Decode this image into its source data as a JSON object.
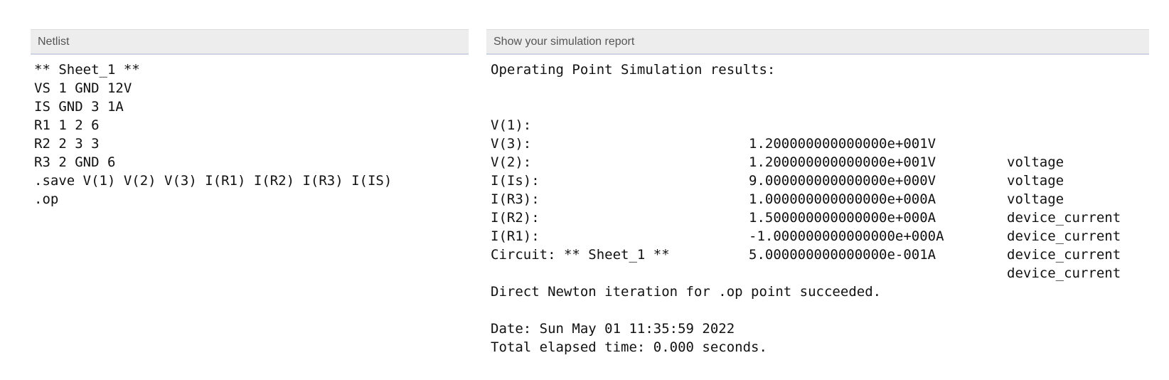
{
  "netlist": {
    "header": "Netlist",
    "lines": [
      "** Sheet_1 **",
      "VS 1 GND 12V",
      "IS GND 3 1A",
      "R1 1 2 6",
      "R2 2 3 3",
      "R3 2 GND 6",
      ".save V(1) V(2) V(3) I(R1) I(R2) I(R3) I(IS)",
      ".op"
    ]
  },
  "report": {
    "header": "Show your simulation report",
    "title": "Operating Point Simulation results:",
    "results": [
      {
        "name": "V(1):",
        "value": "1.200000000000000e+001V",
        "type": "voltage"
      },
      {
        "name": "V(3):",
        "value": "1.200000000000000e+001V",
        "type": "voltage"
      },
      {
        "name": "V(2):",
        "value": "9.000000000000000e+000V",
        "type": "voltage"
      },
      {
        "name": "I(Is):",
        "value": "1.000000000000000e+000A",
        "type": "device_current"
      },
      {
        "name": "I(R3):",
        "value": "1.500000000000000e+000A",
        "type": "device_current"
      },
      {
        "name": "I(R2):",
        "value": "-1.000000000000000e+000A",
        "type": "device_current"
      },
      {
        "name": "I(R1):",
        "value": "5.000000000000000e-001A",
        "type": "device_current"
      }
    ],
    "circuit_line": "Circuit: ** Sheet_1 **",
    "newton_line": "Direct Newton iteration for .op point succeeded.",
    "date_line": "Date: Sun May 01 11:35:59 2022",
    "elapsed_line": "Total elapsed time: 0.000 seconds."
  }
}
